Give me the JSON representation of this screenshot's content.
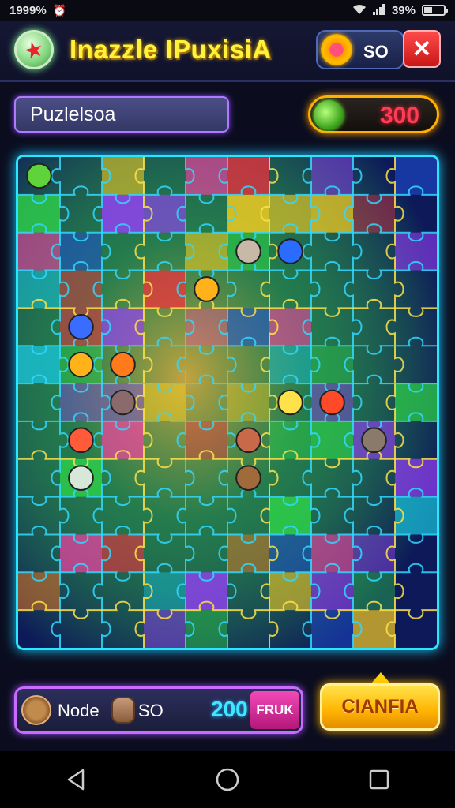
{
  "status_bar": {
    "time": "1999%",
    "battery_text": "39%",
    "icons": [
      "wifi-icon",
      "alarm-icon",
      "signal-icon",
      "battery-icon"
    ]
  },
  "header": {
    "logo_icon": "star-badge-icon",
    "title": "Inazzle IPuxisiA",
    "coins": {
      "icon": "coin-icon",
      "value": "SO"
    },
    "close_label": "✕"
  },
  "info": {
    "player_name": "Puzlelsoa",
    "score_icon": "gem-icon",
    "score": "300"
  },
  "board": {
    "cols": 10,
    "rows": 13,
    "colors": {
      "border": "#29e6ff",
      "accent": "#ffd23a"
    },
    "placed_pieces": "colored neon puzzle pieces with creature artwork"
  },
  "bottom": {
    "player": {
      "icon": "avatar-icon",
      "name": "Node"
    },
    "opponent": {
      "icon": "face-icon",
      "value": "SO"
    },
    "score": "200",
    "tag_label": "FRUK",
    "action_label": "CIANFIA"
  },
  "nav": [
    "back-icon",
    "home-icon",
    "recents-icon"
  ]
}
